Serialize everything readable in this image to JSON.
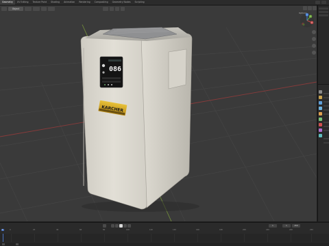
{
  "topbar": {
    "workspaces": [
      "Geometry",
      "UV Editing",
      "Texture Paint",
      "Shading",
      "Animation",
      "Rendering",
      "Compositing",
      "Geometry Nodes",
      "Scripting"
    ],
    "active_workspace": "Geometry"
  },
  "viewport": {
    "mode_label": "Object",
    "options_label": "Options",
    "product": {
      "display_digits": "086",
      "brand": "KARCHER"
    }
  },
  "gizmo": {
    "x": "X",
    "y": "Y",
    "z": "Z"
  },
  "properties": {
    "tab_colors": [
      "#8a8a8a",
      "#c9a34e",
      "#5f9fd8",
      "#6fb4e0",
      "#e0a050",
      "#7ac47a",
      "#d05050",
      "#b06fd0",
      "#5fbfbf"
    ]
  },
  "timeline": {
    "ticks": [
      "0",
      "20",
      "40",
      "60",
      "80",
      "100",
      "120",
      "140",
      "160",
      "180",
      "200",
      "220",
      "240",
      "250"
    ],
    "current_frame": "1",
    "start_frame": "1",
    "end_frame": "250"
  },
  "colors": {
    "grid_x_axis": "#8a3b3b",
    "grid_y_axis": "#6f8a3a",
    "accent": "#4a73c2"
  }
}
